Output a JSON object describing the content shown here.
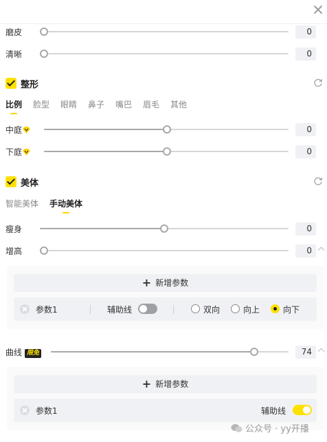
{
  "window": {
    "close_icon": "close-icon"
  },
  "beauty_sliders": [
    {
      "label": "磨皮",
      "value": "0",
      "level": 0
    },
    {
      "label": "清晰",
      "value": "0",
      "level": 0
    }
  ],
  "reshape": {
    "title": "整形",
    "checked": true,
    "tabs": [
      "比例",
      "脸型",
      "眼睛",
      "鼻子",
      "嘴巴",
      "眉毛",
      "其他"
    ],
    "active_tab": "比例",
    "sliders": [
      {
        "label": "中庭",
        "value": "0",
        "level": 0.5,
        "vip": true
      },
      {
        "label": "下庭",
        "value": "0",
        "level": 0.5,
        "vip": true
      }
    ]
  },
  "body": {
    "title": "美体",
    "checked": true,
    "tabs": [
      "智能美体",
      "手动美体"
    ],
    "active_tab": "手动美体",
    "sliders": [
      {
        "label": "瘦身",
        "value": "0",
        "level": 0.5
      },
      {
        "label": "增高",
        "value": "0",
        "level": 0
      }
    ],
    "panel1": {
      "add_label": "新增参数",
      "param": {
        "name": "参数1",
        "guide_label": "辅助线",
        "guide_on": false,
        "directions": [
          "双向",
          "向上",
          "向下"
        ],
        "selected_direction": "向下"
      }
    },
    "curve": {
      "label": "曲线",
      "badge": "限免",
      "value": "74",
      "level": 0.74
    },
    "panel2": {
      "add_label": "新增参数",
      "param": {
        "name": "参数1",
        "guide_label": "辅助线",
        "guide_on": true
      }
    }
  },
  "watermark": {
    "text": "公众号 · yy开播"
  },
  "colors": {
    "accent": "#ffe100",
    "track": "#d6d6d6",
    "knob_border": "#a8a8a8",
    "value_box": "#f0f1f4"
  }
}
